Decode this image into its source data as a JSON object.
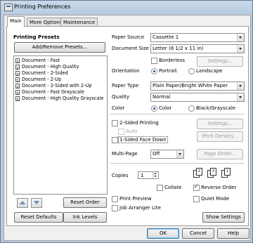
{
  "window": {
    "title": "Printing Preferences"
  },
  "tabs": [
    {
      "label": "Main"
    },
    {
      "label": "More Options"
    },
    {
      "label": "Maintenance"
    }
  ],
  "presets": {
    "heading": "Printing Presets",
    "add_remove_label": "Add/Remove Presets...",
    "items": [
      "Document - Fast",
      "Document - High Quality",
      "Document - 2-Sided",
      "Document - 2-Up",
      "Document - 2-Sided with 2-Up",
      "Document - Fast Grayscale",
      "Document - High Quality Grayscale"
    ],
    "reset_order_label": "Reset Order"
  },
  "settings": {
    "paper_source_label": "Paper Source",
    "paper_source_value": "Cassette 1",
    "document_size_label": "Document Size",
    "document_size_value": "Letter (8 1/2 x 11 in)",
    "borderless_label": "Borderless",
    "settings_button_label": "Settings...",
    "orientation_label": "Orientation",
    "portrait_label": "Portrait",
    "landscape_label": "Landscape",
    "paper_type_label": "Paper Type",
    "paper_type_value": "Plain Paper/Bright White Paper",
    "quality_label": "Quality",
    "quality_value": "Normal",
    "color_label": "Color",
    "color_option_label": "Color",
    "grayscale_label": "Black/Grayscale",
    "two_sided_label": "2-Sided Printing",
    "two_sided_settings_label": "Settings...",
    "auto_label": "Auto",
    "print_density_label": "Print Density...",
    "one_sided_face_down_label": "1-Sided Face Down",
    "multi_page_label": "Multi-Page",
    "multi_page_value": "Off",
    "page_order_label": "Page Order...",
    "copies_label": "Copies",
    "copies_value": "1",
    "collate_label": "Collate",
    "reverse_order_label": "Reverse Order",
    "print_preview_label": "Print Preview",
    "quiet_mode_label": "Quiet Mode",
    "job_arranger_label": "Job Arranger Lite",
    "page_icons": [
      "1",
      "2",
      "3"
    ]
  },
  "footer": {
    "reset_defaults_label": "Reset Defaults",
    "ink_levels_label": "Ink Levels",
    "show_settings_label": "Show Settings",
    "ok_label": "OK",
    "cancel_label": "Cancel",
    "help_label": "Help"
  }
}
